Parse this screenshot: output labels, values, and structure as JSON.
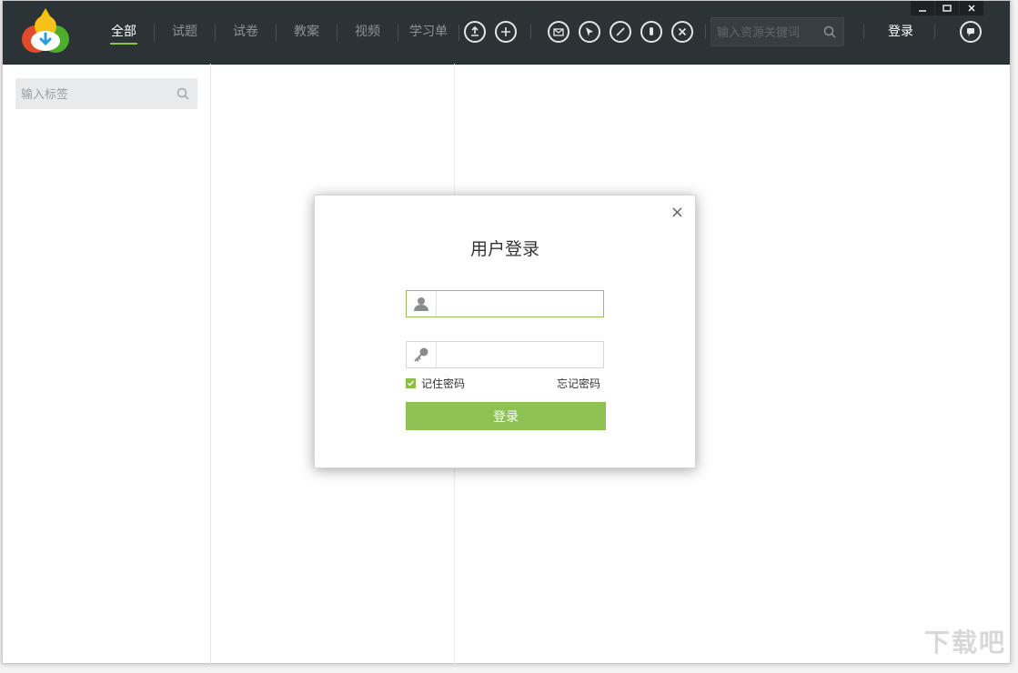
{
  "nav": {
    "items": [
      {
        "label": "全部",
        "active": true
      },
      {
        "label": "试题",
        "active": false
      },
      {
        "label": "试卷",
        "active": false
      },
      {
        "label": "教案",
        "active": false
      },
      {
        "label": "视频",
        "active": false
      },
      {
        "label": "学习单",
        "active": false
      }
    ]
  },
  "toolbar": {
    "icons": [
      "upload-icon",
      "add-icon",
      "message-icon",
      "cursor-icon",
      "pen-icon",
      "eraser-icon",
      "close-circle-icon"
    ]
  },
  "search": {
    "placeholder": "输入资源关键词"
  },
  "header": {
    "login_label": "登录"
  },
  "sidebar": {
    "tag_placeholder": "输入标签"
  },
  "dialog": {
    "title": "用户登录",
    "username_value": "",
    "password_value": "",
    "remember_label": "记住密码",
    "remember_checked": true,
    "forgot_label": "忘记密码",
    "login_button": "登录",
    "close_symbol": "×"
  },
  "colors": {
    "topbar": "#2b3336",
    "accent": "#8dc152",
    "active_nav_underline": "#8cc43e"
  },
  "watermark": {
    "text": "下载吧"
  }
}
